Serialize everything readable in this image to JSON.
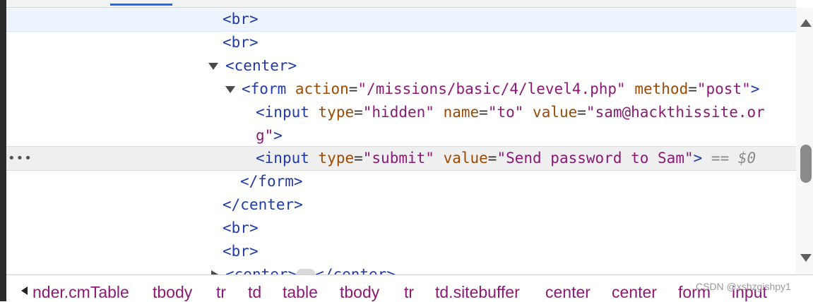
{
  "dom_lines": [
    {
      "id": "br-1",
      "tag": "br"
    },
    {
      "id": "br-2",
      "tag": "br"
    },
    {
      "id": "center-open",
      "tag": "center"
    },
    {
      "id": "form-open",
      "tag": "form",
      "attrs": [
        {
          "name": "action",
          "value": "\"/missions/basic/4/level4.php\""
        },
        {
          "name": "method",
          "value": "\"post\""
        }
      ]
    },
    {
      "id": "input-hidden",
      "tag": "input",
      "attrs": [
        {
          "name": "type",
          "value": "\"hidden\""
        },
        {
          "name": "name",
          "value": "\"to\""
        },
        {
          "name": "value",
          "value_part1": "\"sam@hackthissite.or",
          "value_part2": "g\""
        }
      ]
    },
    {
      "id": "input-submit",
      "tag": "input",
      "attrs": [
        {
          "name": "type",
          "value": "\"submit\""
        },
        {
          "name": "value",
          "value": "\"Send password to Sam\""
        }
      ],
      "marker": "== $0"
    },
    {
      "id": "form-close",
      "tag": "/form"
    },
    {
      "id": "center-close",
      "tag": "/center"
    },
    {
      "id": "br-3",
      "tag": "br"
    },
    {
      "id": "br-4",
      "tag": "br"
    },
    {
      "id": "center-collapsed",
      "tag": "center",
      "close_tag": "/center"
    }
  ],
  "selected_line_menu": "•••",
  "breadcrumbs": [
    "nder.cmTable",
    "tbody",
    "tr",
    "td",
    "table",
    "tbody",
    "tr",
    "td.sitebuffer",
    "center",
    "center",
    "form",
    "input"
  ],
  "watermark": "CSDN @xshzgishpy1"
}
